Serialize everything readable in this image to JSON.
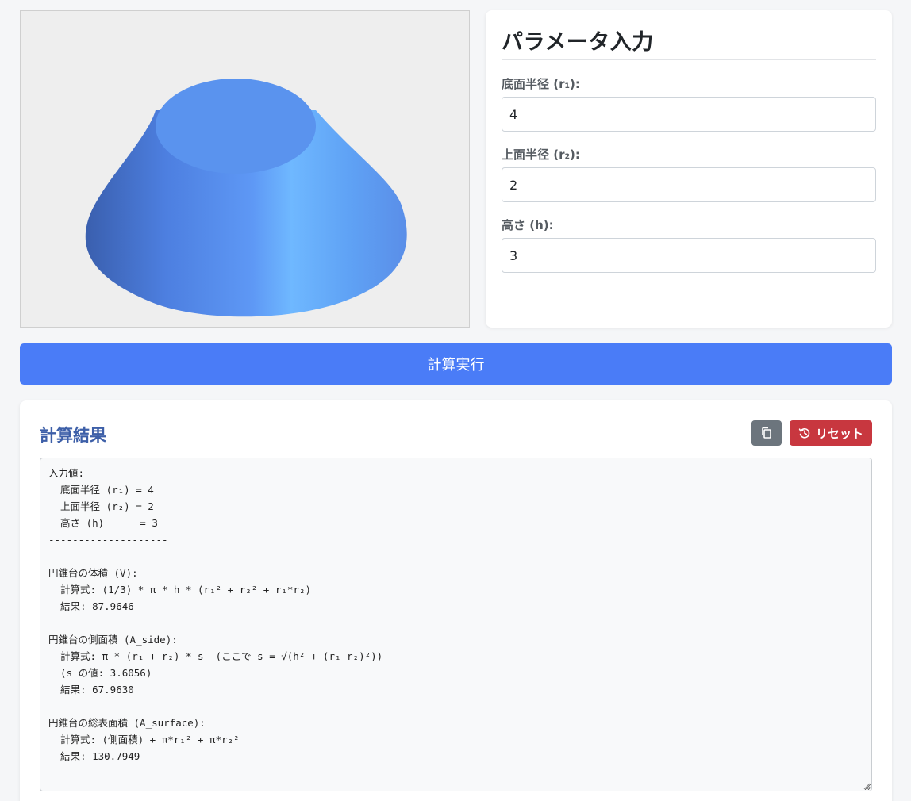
{
  "param_panel": {
    "title": "パラメータ入力",
    "fields": [
      {
        "label": "底面半径 (r₁):",
        "value": "4"
      },
      {
        "label": "上面半径 (r₂):",
        "value": "2"
      },
      {
        "label": "高さ (h):",
        "value": "3"
      }
    ]
  },
  "calculate_button": {
    "label": "計算実行"
  },
  "results": {
    "title": "計算結果",
    "copy_icon": "copy-icon",
    "reset_icon": "history-icon",
    "reset_label": "リセット",
    "output": "入力値:\n  底面半径 (r₁) = 4\n  上面半径 (r₂) = 2\n  高さ (h)      = 3\n--------------------\n\n円錐台の体積 (V):\n  計算式: (1/3) * π * h * (r₁² + r₂² + r₁*r₂)\n  結果: 87.9646\n\n円錐台の側面積 (A_side):\n  計算式: π * (r₁ + r₂) * s  (ここで s = √(h² + (r₁-r₂)²))\n  (s の値: 3.6056)\n  結果: 67.9630\n\n円錐台の総表面積 (A_surface):\n  計算式: (側面積) + π*r₁² + π*r₂²\n  結果: 130.7949"
  },
  "colors": {
    "primary_button": "#4a7cf7",
    "reset_button": "#c8373f",
    "copy_button": "#6c757d",
    "result_title": "#3d5fa8",
    "frustum_light": "#6fb8ff",
    "frustum_dark": "#3a5fae",
    "frustum_top": "#5a93ee"
  }
}
